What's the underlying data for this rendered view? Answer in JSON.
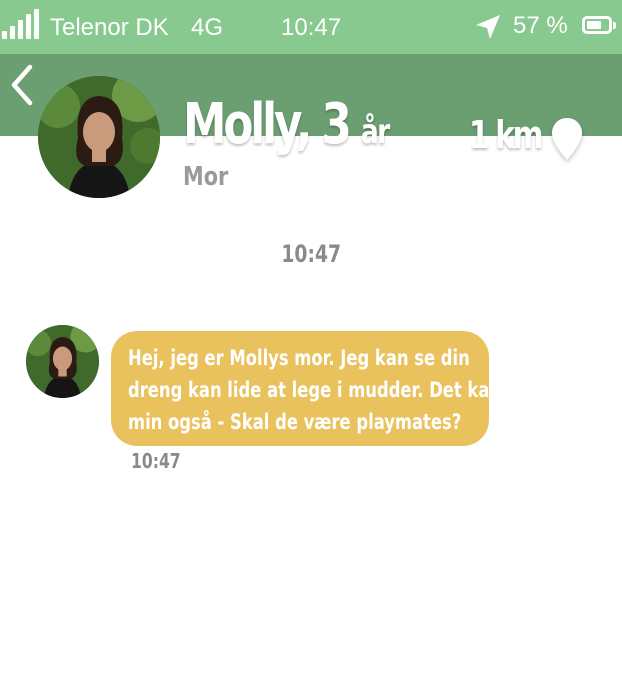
{
  "status_bar": {
    "carrier": "Telenor DK",
    "network": "4G",
    "time": "10:47",
    "battery_percent": "57 %",
    "battery_level": 0.57
  },
  "header": {
    "name": "Molly, 3",
    "age_unit": "år",
    "distance": "1 km",
    "role": "Mor"
  },
  "chat": {
    "timestamp": "10:47",
    "messages": [
      {
        "lines": [
          "Hej, jeg er Mollys mor. Jeg kan se din",
          "dreng kan lide at lege i mudder. Det kan",
          "min også - Skal de være playmates?"
        ],
        "time": "10:47"
      }
    ]
  },
  "colors": {
    "status_bar": "#88c98f",
    "header": "#6b9f72",
    "bubble": "#e9c25d"
  }
}
